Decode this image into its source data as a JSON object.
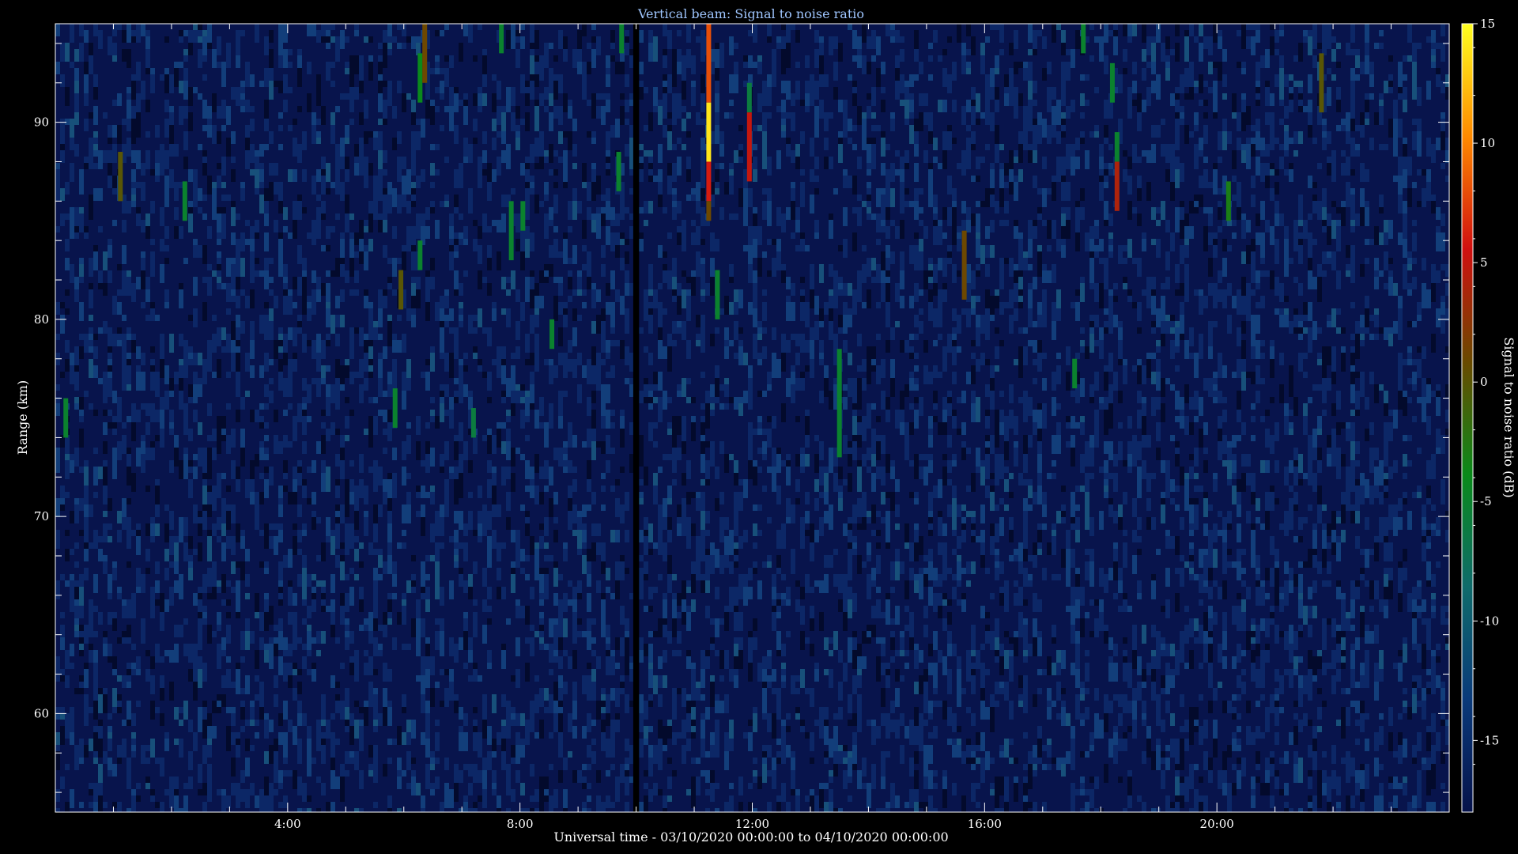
{
  "chart_data": {
    "type": "heatmap",
    "title": "Vertical beam: Signal to noise ratio",
    "xlabel": "Universal time - 03/10/2020 00:00:00 to 04/10/2020 00:00:00",
    "ylabel": "Range (km)",
    "x_unit": "hours UT",
    "xlim": [
      0,
      24
    ],
    "x_ticks": [
      {
        "value": 4,
        "label": "4:00"
      },
      {
        "value": 8,
        "label": "8:00"
      },
      {
        "value": 12,
        "label": "12:00"
      },
      {
        "value": 16,
        "label": "16:00"
      },
      {
        "value": 20,
        "label": "20:00"
      }
    ],
    "ylim": [
      55,
      95
    ],
    "y_ticks": [
      {
        "value": 60,
        "label": "60"
      },
      {
        "value": 70,
        "label": "70"
      },
      {
        "value": 80,
        "label": "80"
      },
      {
        "value": 90,
        "label": "90"
      }
    ],
    "colorbar": {
      "label": "Signal to noise ratio (dB)",
      "range": [
        -18,
        15
      ],
      "ticks": [
        {
          "value": 15,
          "label": "15"
        },
        {
          "value": 10,
          "label": "10"
        },
        {
          "value": 5,
          "label": "5"
        },
        {
          "value": 0,
          "label": "0"
        },
        {
          "value": -5,
          "label": "-5"
        },
        {
          "value": -10,
          "label": "-10"
        },
        {
          "value": -15,
          "label": "-15"
        }
      ],
      "colors": [
        "#06124a",
        "#0a3a7a",
        "#0f6b6b",
        "#0a8a1a",
        "#6a4a00",
        "#d01010",
        "#ff8a00",
        "#ffff20"
      ]
    },
    "background_db": -16,
    "data_gap_hours": [
      9.95,
      10.05
    ],
    "echoes": [
      {
        "time": 0.18,
        "range_top": 76,
        "range_bottom": 74,
        "db": -5
      },
      {
        "time": 1.12,
        "range_top": 88.5,
        "range_bottom": 86,
        "db": 0
      },
      {
        "time": 2.23,
        "range_top": 87,
        "range_bottom": 85,
        "db": -5
      },
      {
        "time": 5.85,
        "range_top": 76.5,
        "range_bottom": 74.5,
        "db": -5
      },
      {
        "time": 5.95,
        "range_top": 82.5,
        "range_bottom": 80.5,
        "db": 0
      },
      {
        "time": 6.28,
        "range_top": 93.5,
        "range_bottom": 91,
        "db": -4
      },
      {
        "time": 6.28,
        "range_top": 84,
        "range_bottom": 82.5,
        "db": -5
      },
      {
        "time": 6.36,
        "range_top": 95,
        "range_bottom": 92,
        "db": 1
      },
      {
        "time": 7.2,
        "range_top": 75.5,
        "range_bottom": 74,
        "db": -6
      },
      {
        "time": 7.68,
        "range_top": 95,
        "range_bottom": 93.5,
        "db": -5
      },
      {
        "time": 7.85,
        "range_top": 86,
        "range_bottom": 83,
        "db": -5
      },
      {
        "time": 8.05,
        "range_top": 86,
        "range_bottom": 84.5,
        "db": -5
      },
      {
        "time": 8.55,
        "range_top": 80,
        "range_bottom": 78.5,
        "db": -5
      },
      {
        "time": 9.7,
        "range_top": 88.5,
        "range_bottom": 86.5,
        "db": -5
      },
      {
        "time": 9.75,
        "range_top": 95,
        "range_bottom": 93.5,
        "db": -5
      },
      {
        "time": 11.25,
        "range_top": 95,
        "range_bottom": 91,
        "db": 8
      },
      {
        "time": 11.25,
        "range_top": 91,
        "range_bottom": 88,
        "db": 14
      },
      {
        "time": 11.25,
        "range_top": 88,
        "range_bottom": 86,
        "db": 6
      },
      {
        "time": 11.25,
        "range_top": 86,
        "range_bottom": 85,
        "db": 1
      },
      {
        "time": 11.4,
        "range_top": 82.5,
        "range_bottom": 80,
        "db": -5
      },
      {
        "time": 11.95,
        "range_top": 92,
        "range_bottom": 90.5,
        "db": -6
      },
      {
        "time": 11.95,
        "range_top": 90.5,
        "range_bottom": 87,
        "db": 5
      },
      {
        "time": 13.5,
        "range_top": 78.5,
        "range_bottom": 76,
        "db": -5
      },
      {
        "time": 13.5,
        "range_top": 76,
        "range_bottom": 73,
        "db": -5
      },
      {
        "time": 15.65,
        "range_top": 84.5,
        "range_bottom": 81,
        "db": 1
      },
      {
        "time": 17.55,
        "range_top": 78,
        "range_bottom": 76.5,
        "db": -5
      },
      {
        "time": 17.7,
        "range_top": 95,
        "range_bottom": 93.5,
        "db": -5
      },
      {
        "time": 18.2,
        "range_top": 93,
        "range_bottom": 91,
        "db": -5
      },
      {
        "time": 18.28,
        "range_top": 89.5,
        "range_bottom": 88,
        "db": -5
      },
      {
        "time": 18.28,
        "range_top": 88,
        "range_bottom": 85.5,
        "db": 4
      },
      {
        "time": 20.2,
        "range_top": 87,
        "range_bottom": 85,
        "db": -3
      },
      {
        "time": 21.8,
        "range_top": 93.5,
        "range_bottom": 90.5,
        "db": 0
      }
    ]
  }
}
